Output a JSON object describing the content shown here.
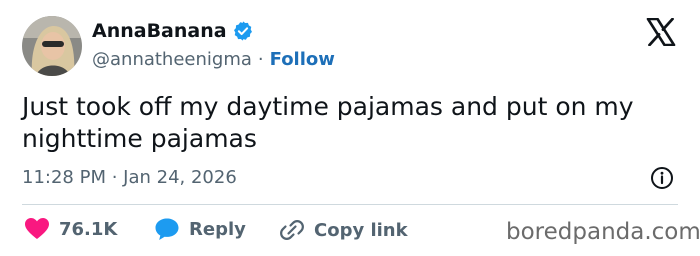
{
  "author": {
    "display_name": "AnnaBanana",
    "handle": "@annatheenigma",
    "separator": "·",
    "follow_label": "Follow"
  },
  "tweet": {
    "text": "Just took off my daytime pajamas and put on my nighttime pajamas",
    "timestamp": "11:28 PM · Jan 24, 2026"
  },
  "actions": {
    "likes_count": "76.1K",
    "reply_label": "Reply",
    "copy_link_label": "Copy link"
  },
  "watermark": "boredpanda.com",
  "colors": {
    "verified_badge": "#1d9bf0",
    "follow_link": "#1d6fb8",
    "like_heart": "#f91880",
    "reply_bubble": "#1d9bf0",
    "secondary_text": "#536471"
  },
  "icons": {
    "verified": "verified-badge-icon",
    "logo": "x-logo-icon",
    "info": "info-icon",
    "like": "heart-icon",
    "reply": "speech-bubble-icon",
    "copy_link": "link-icon"
  }
}
